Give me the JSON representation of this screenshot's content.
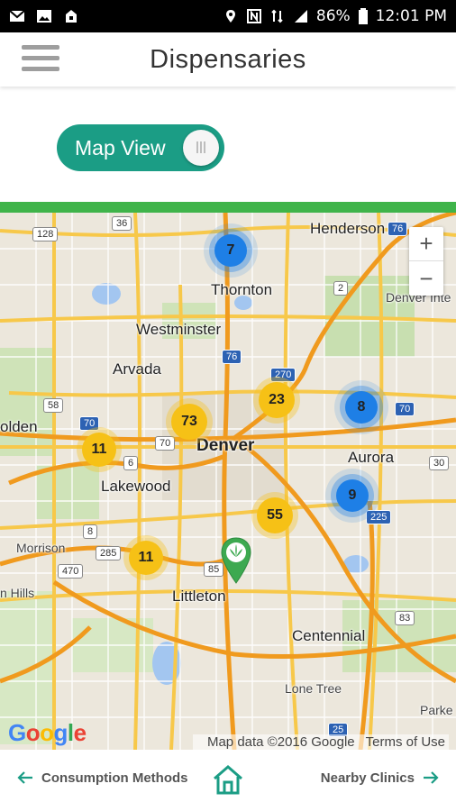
{
  "status_bar": {
    "battery": "86%",
    "time": "12:01 PM"
  },
  "app_bar": {
    "title": "Dispensaries",
    "menu_icon": "hamburger-menu-icon"
  },
  "view_toggle": {
    "label": "Map View",
    "state": "on"
  },
  "colors": {
    "accent_teal": "#1b9d85",
    "accent_green": "#3fb44a",
    "cluster_yellow": "#f6c116",
    "cluster_blue": "#1e7fe6"
  },
  "map": {
    "places": {
      "henderson": "Henderson",
      "thornton": "Thornton",
      "westminster": "Westminster",
      "arvada": "Arvada",
      "denver": "Denver",
      "golden": "olden",
      "lakewood": "Lakewood",
      "aurora": "Aurora",
      "morrison": "Morrison",
      "hills": "n Hills",
      "littleton": "Littleton",
      "centennial": "Centennial",
      "lone_tree": "Lone Tree",
      "parker": "Parke",
      "denver_intl": "Denver Inte"
    },
    "shields": {
      "s36": "36",
      "s128": "128",
      "s76a": "76",
      "s2": "2",
      "s76b": "76",
      "s270": "270",
      "s58": "58",
      "s70a": "70",
      "s70b": "70",
      "s70c": "70",
      "s6": "6",
      "s30": "30",
      "s8": "8",
      "s285": "285",
      "s470": "470",
      "s85": "85",
      "s225": "225",
      "s83": "83",
      "s25": "25"
    },
    "clusters": {
      "c_thornton": "7",
      "c_73": "73",
      "c_23": "23",
      "c_8": "8",
      "c_11a": "11",
      "c_9": "9",
      "c_55": "55",
      "c_11b": "11"
    },
    "zoom_in": "+",
    "zoom_out": "−",
    "google": "Google",
    "map_data": "Map data ©2016 Google",
    "terms": "Terms of Use"
  },
  "bottom_nav": {
    "left_label": "Consumption Methods",
    "right_label": "Nearby Clinics"
  }
}
